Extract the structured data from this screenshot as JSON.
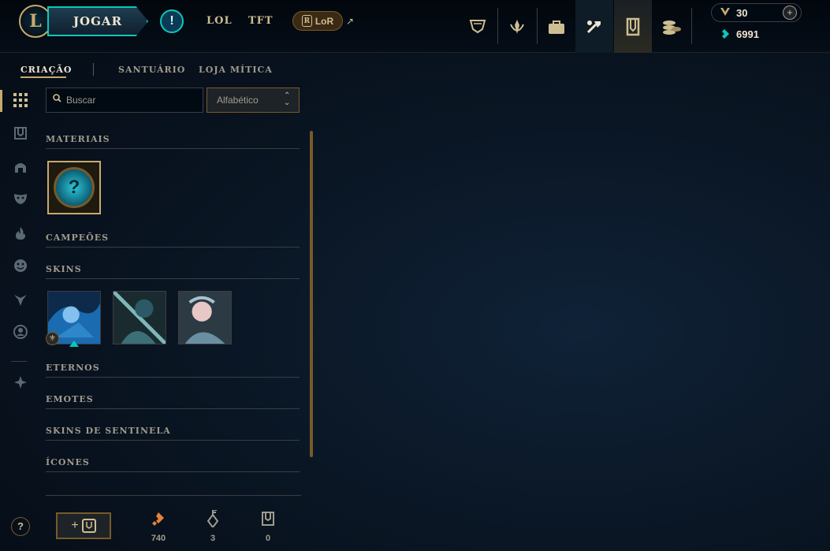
{
  "header": {
    "logo_letter": "L",
    "play_label": "JOGAR",
    "nav": [
      "LOL",
      "TFT"
    ],
    "lor_label": "LoR",
    "lor_badge": "R",
    "external_glyph": "↗",
    "alert_glyph": "!",
    "top_icons": [
      "trophy-icon",
      "clash-icon",
      "store-bag-icon",
      "crafting-icon",
      "collection-icon",
      "currency-store-icon"
    ],
    "active_top_icon": "collection-icon",
    "rp_value": "30",
    "be_value": "6991"
  },
  "subnav": {
    "tabs": [
      "CRIAÇÃO",
      "SANTUÁRIO",
      "LOJA MÍTICA"
    ],
    "active": "CRIAÇÃO"
  },
  "sidebar": {
    "icons": [
      "grid-icon",
      "chest-icon",
      "helmet-icon",
      "mask-icon",
      "flame-icon",
      "emote-face-icon",
      "ward-icon",
      "profile-icon",
      "companion-icon"
    ],
    "active": "grid-icon",
    "help_glyph": "?"
  },
  "filters": {
    "search_placeholder": "Buscar",
    "sort_value": "Alfabético"
  },
  "sections": {
    "materiais": "MATERIAIS",
    "campeoes": "CAMPEÕES",
    "skins": "SKINS",
    "eternos": "ETERNOS",
    "emotes": "EMOTES",
    "skins_sentinela": "SKINS DE SENTINELA",
    "icones": "ÍCONES"
  },
  "materials": [
    {
      "name": "mystery-orb",
      "glyph": "?"
    }
  ],
  "skins": [
    {
      "name": "skin-1",
      "colors": [
        "#1a6bb0",
        "#9fd6ff",
        "#0d2a4a"
      ]
    },
    {
      "name": "skin-2",
      "colors": [
        "#2b5a66",
        "#7fb7b8",
        "#1a2b30"
      ]
    },
    {
      "name": "skin-3",
      "colors": [
        "#6a8fa0",
        "#e8c7c7",
        "#2c3a44"
      ]
    }
  ],
  "footer": {
    "add_label": "+",
    "orange_essence": "740",
    "keys": "3",
    "chests": "0"
  },
  "colors": {
    "gold": "#c8aa6e",
    "teal": "#0ac8b9",
    "text": "#a09b8c"
  }
}
